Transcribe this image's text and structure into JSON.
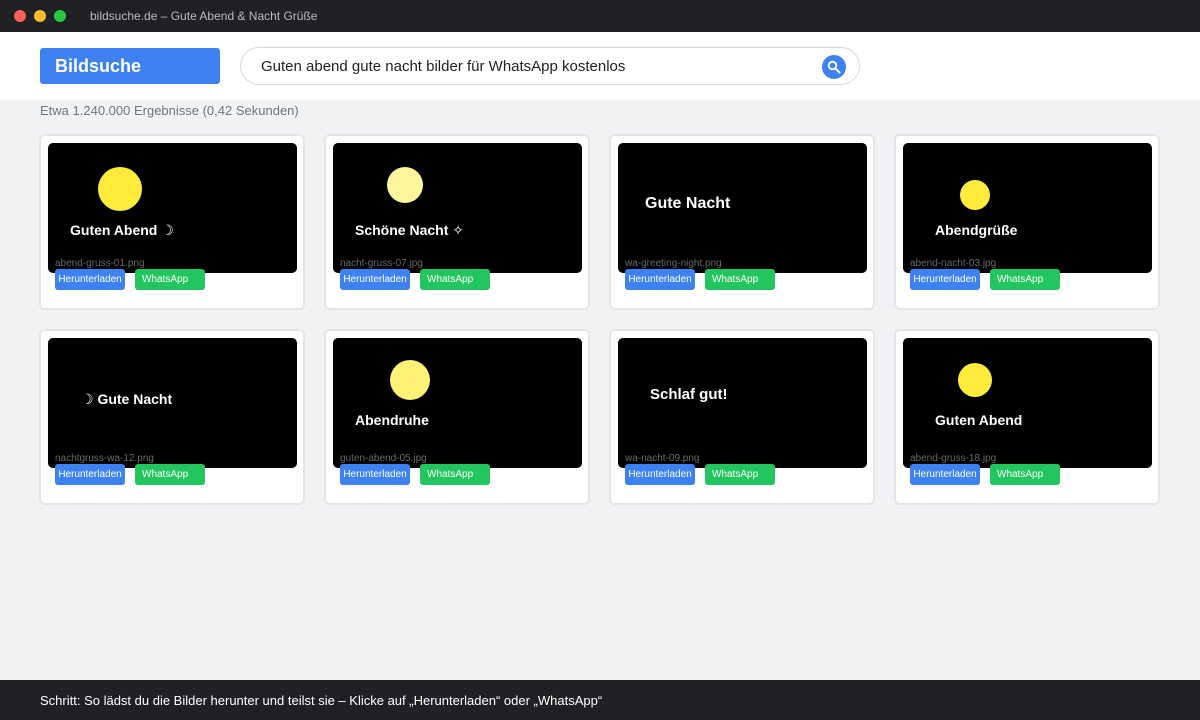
{
  "window": {
    "title": "bildsuche.de – Gute Abend & Nacht Grüße"
  },
  "header": {
    "logo": "Bildsuche",
    "search_query": "Guten abend gute nacht bilder für WhatsApp kostenlos",
    "search_icon": "search-icon"
  },
  "results": {
    "stats": "Etwa 1.240.000 Ergebnisse (0,42 Sekunden)",
    "download_label": "Herunterladen",
    "whatsapp_label": "WhatsApp",
    "cards": [
      {
        "caption": "Guten Abend ☽",
        "filename": "abend-gruss-01.png",
        "sun_color": "#ffeb3b"
      },
      {
        "caption": "Schöne Nacht ✧",
        "filename": "nacht-gruss-07.jpg",
        "sun_color": "#fff59d"
      },
      {
        "caption": "Gute Nacht",
        "filename": "wa-greeting-night.png"
      },
      {
        "caption": "Abendgrüße",
        "filename": "abend-nacht-03.jpg",
        "sun_color": "#ffeb3b"
      },
      {
        "caption": "☽  Gute Nacht",
        "filename": "nachtgruss-wa-12.png"
      },
      {
        "caption": "Abendruhe",
        "filename": "guten-abend-05.jpg",
        "sun_color": "#fff176"
      },
      {
        "caption": "Schlaf gut!",
        "filename": "wa-nacht-09.png"
      },
      {
        "caption": "Guten Abend",
        "filename": "abend-gruss-18.jpg",
        "sun_color": "#ffeb3b"
      }
    ]
  },
  "footer": {
    "text": "Schritt: So lädst du die Bilder herunter und teilst sie – Klicke auf „Herunterladen“ oder „WhatsApp“"
  }
}
